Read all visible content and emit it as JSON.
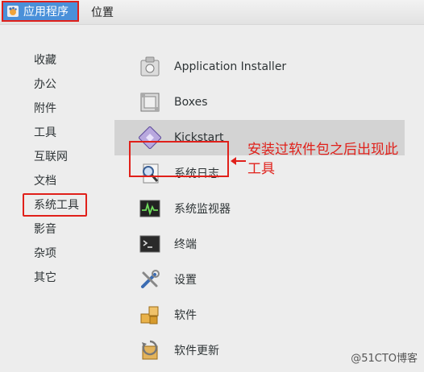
{
  "topbar": {
    "apps_menu_label": "应用程序",
    "places_label": "位置"
  },
  "categories": [
    "收藏",
    "办公",
    "附件",
    "工具",
    "互联网",
    "文档",
    "系统工具",
    "影音",
    "杂项",
    "其它"
  ],
  "apps": [
    {
      "label": "Application Installer",
      "icon": "package-installer-icon"
    },
    {
      "label": "Boxes",
      "icon": "boxes-icon"
    },
    {
      "label": "Kickstart",
      "icon": "kickstart-icon"
    },
    {
      "label": "系统日志",
      "icon": "system-log-icon"
    },
    {
      "label": "系统监视器",
      "icon": "system-monitor-icon"
    },
    {
      "label": "终端",
      "icon": "terminal-icon"
    },
    {
      "label": "设置",
      "icon": "settings-icon"
    },
    {
      "label": "软件",
      "icon": "software-icon"
    },
    {
      "label": "软件更新",
      "icon": "software-update-icon"
    }
  ],
  "annotation": {
    "text": "安装过软件包之后出现此工具"
  },
  "watermark": "@51CTO博客",
  "colors": {
    "highlight_red": "#e0201a",
    "menu_bg": "#ededed",
    "apps_button_bg": "#4a90d9"
  }
}
